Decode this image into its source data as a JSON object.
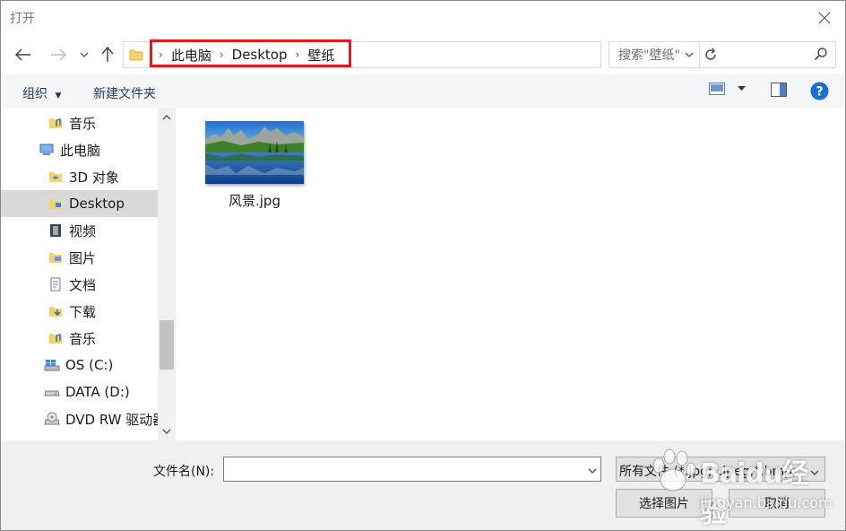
{
  "window": {
    "title": "打开"
  },
  "address": {
    "crumbs": [
      "此电脑",
      "Desktop",
      "壁纸"
    ]
  },
  "search": {
    "placeholder": "搜索\"壁纸\""
  },
  "toolbar": {
    "organize": "组织",
    "new_folder": "新建文件夹"
  },
  "nav": {
    "items": [
      {
        "label": "音乐",
        "icon": "music-folder-icon"
      },
      {
        "label": "此电脑",
        "icon": "computer-icon"
      },
      {
        "label": "3D 对象",
        "icon": "3d-objects-icon"
      },
      {
        "label": "Desktop",
        "icon": "desktop-folder-icon",
        "selected": true
      },
      {
        "label": "视频",
        "icon": "video-folder-icon"
      },
      {
        "label": "图片",
        "icon": "pictures-folder-icon"
      },
      {
        "label": "文档",
        "icon": "documents-folder-icon"
      },
      {
        "label": "下载",
        "icon": "downloads-folder-icon"
      },
      {
        "label": "音乐",
        "icon": "music-folder-icon"
      },
      {
        "label": "OS (C:)",
        "icon": "windows-drive-icon"
      },
      {
        "label": "DATA (D:)",
        "icon": "drive-icon"
      },
      {
        "label": "DVD RW 驱动器",
        "icon": "dvd-drive-icon"
      }
    ]
  },
  "files": [
    {
      "name": "风景.jpg",
      "icon": "landscape-thumbnail"
    }
  ],
  "bottom": {
    "filename_label": "文件名(N):",
    "filename_value": "",
    "filetype_value": "所有文件 (*.jpg;*.jpeg;*.bmp;",
    "open_button": "选择图片",
    "cancel_button": "取消"
  },
  "watermark": {
    "text": "Baidu经验",
    "sub": "jingyan.baidu.com"
  },
  "colors": {
    "highlight": "#e01a1a",
    "selected_bg": "#d9d9d9",
    "help_blue": "#1a6fd4"
  }
}
